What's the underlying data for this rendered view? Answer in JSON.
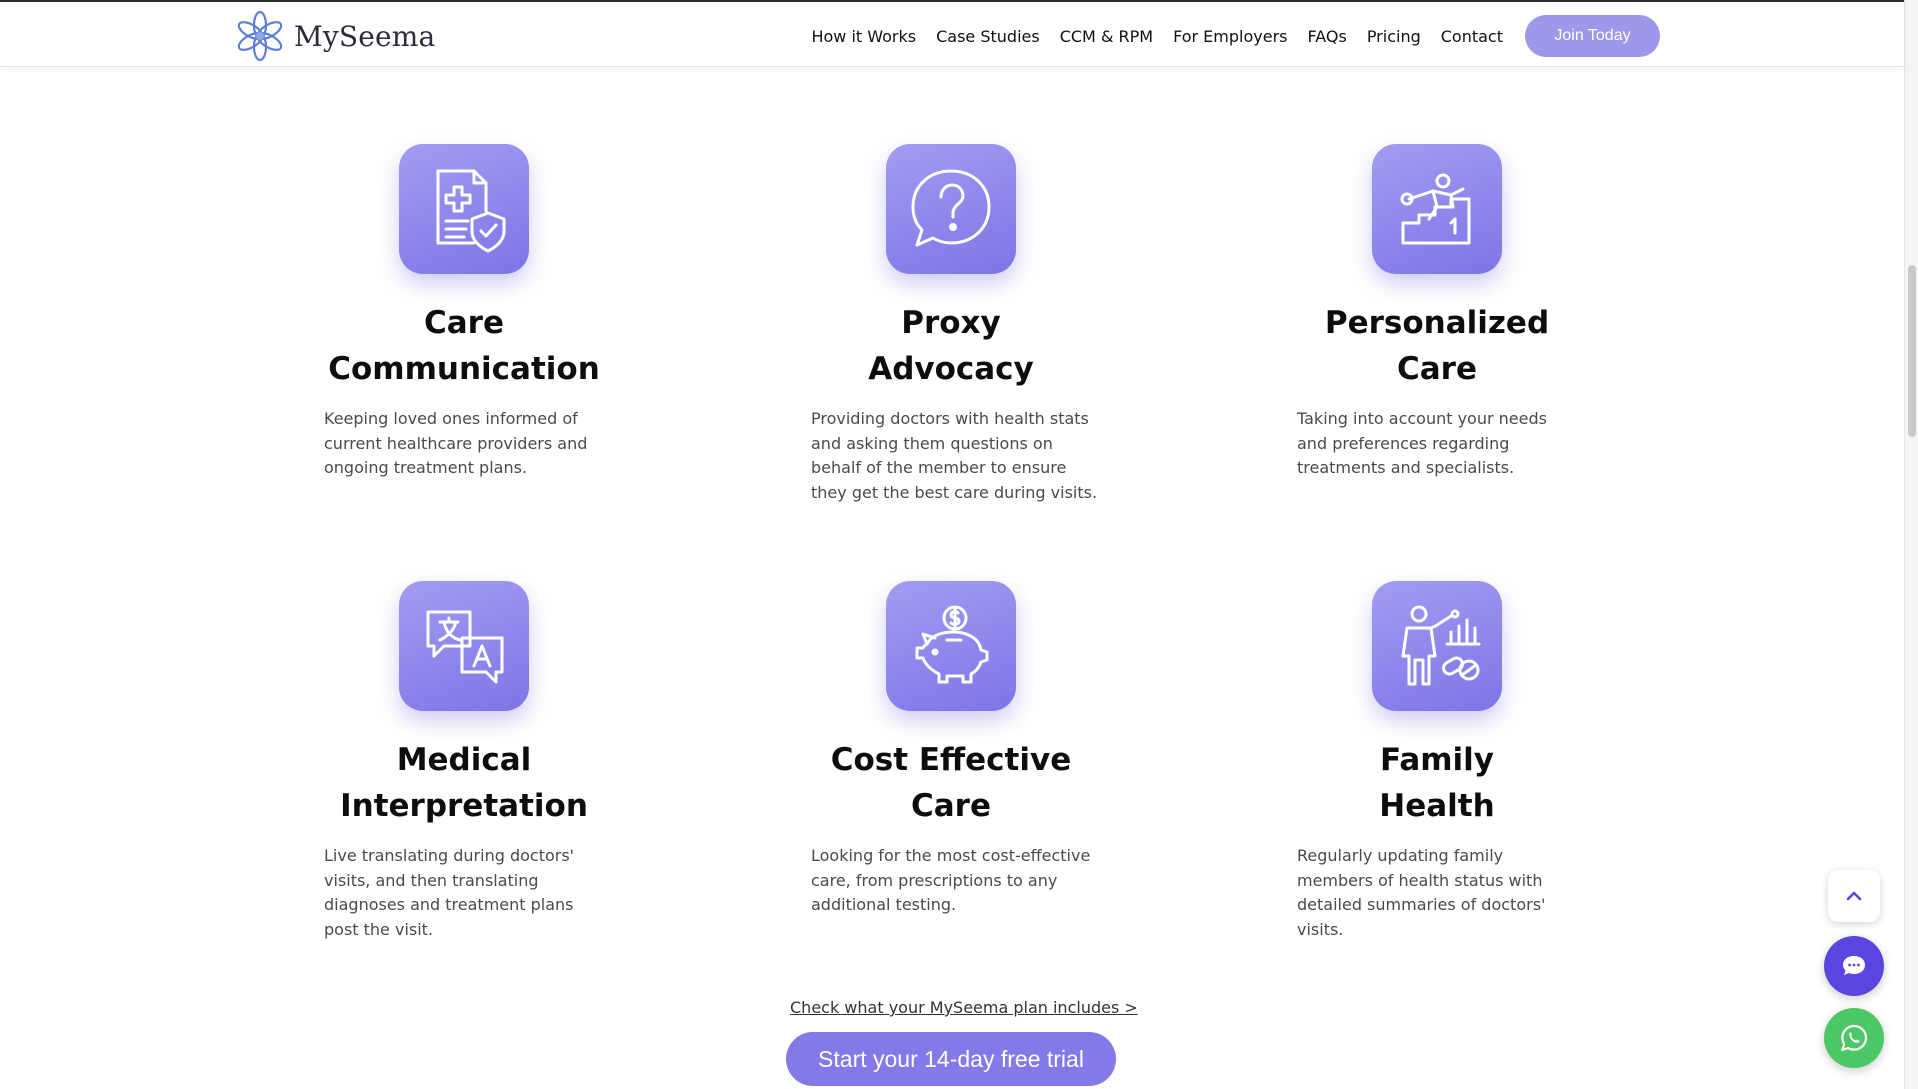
{
  "header": {
    "logo_text": "MySeema",
    "nav": [
      "How it Works",
      "Case Studies",
      "CCM & RPM",
      "For Employers",
      "FAQs",
      "Pricing",
      "Contact"
    ],
    "cta": "Join Today"
  },
  "features": [
    {
      "title_line1": "Care",
      "title_line2": "Communication",
      "icon": "medical-document-shield-icon",
      "desc": [
        "Keeping loved ones informed of",
        "current healthcare providers and",
        "ongoing treatment plans."
      ]
    },
    {
      "title_line1": "Proxy",
      "title_line2": "Advocacy",
      "icon": "question-bubble-icon",
      "desc": [
        "Providing doctors with health stats",
        "and asking them questions on",
        "behalf of the member to ensure",
        "they get the best care during visits."
      ]
    },
    {
      "title_line1": "Personalized",
      "title_line2": "Care",
      "icon": "person-climbing-stairs-icon",
      "desc": [
        "Taking into account your needs",
        "and preferences regarding",
        "treatments and specialists."
      ]
    },
    {
      "title_line1": "Medical",
      "title_line2": "Interpretation",
      "icon": "translation-bubbles-icon",
      "desc": [
        "Live translating during doctors'",
        "visits, and then translating",
        "diagnoses and treatment plans",
        "post the visit."
      ]
    },
    {
      "title_line1": "Cost Effective",
      "title_line2": "Care",
      "icon": "piggy-bank-icon",
      "desc": [
        "Looking for the most cost-effective",
        "care, from prescriptions to any",
        "additional testing."
      ]
    },
    {
      "title_line1": "Family",
      "title_line2": "Health",
      "icon": "person-health-stats-icon",
      "desc": [
        "Regularly updating family",
        "members of health status with",
        "detailed summaries of doctors'",
        "visits."
      ]
    }
  ],
  "plan_link": "Check what your MySeema plan includes >",
  "trial_button": "Start your 14-day free trial",
  "colors": {
    "accent": "#8479e8",
    "tile_light": "#a39cf2",
    "tile_dark": "#7d75e6",
    "chat": "#5b45e0",
    "whatsapp": "#4cc766"
  }
}
